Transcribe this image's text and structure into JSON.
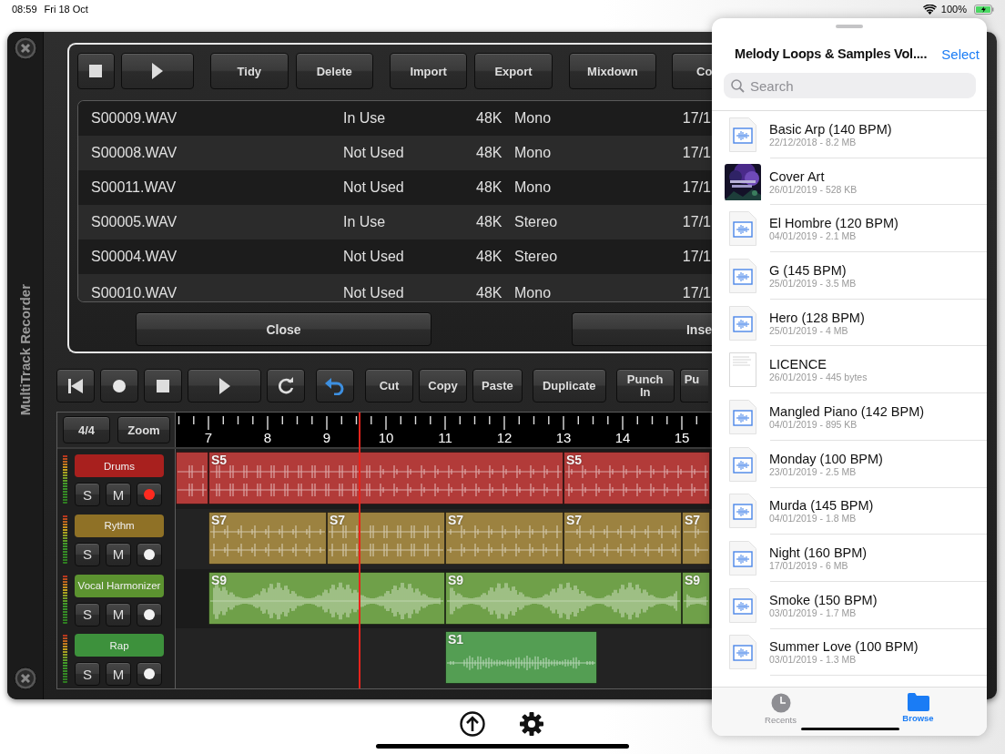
{
  "status_bar": {
    "time": "08:59",
    "date": "Fri 18 Oct",
    "battery": "100%"
  },
  "app": {
    "title": "MultiTrack Recorder",
    "dialog": {
      "toolbar": [
        {
          "kind": "stop"
        },
        {
          "kind": "play"
        },
        {
          "kind": "text",
          "label": "Tidy"
        },
        {
          "kind": "text",
          "label": "Delete"
        },
        {
          "kind": "text",
          "label": "Import"
        },
        {
          "kind": "text",
          "label": "Export"
        },
        {
          "kind": "text",
          "label": "Mixdown"
        },
        {
          "kind": "text",
          "label": "Co"
        }
      ],
      "files": [
        {
          "name": "S00009.WAV",
          "status": "In Use",
          "rate": "48K",
          "channels": "Mono",
          "date": "17/1"
        },
        {
          "name": "S00008.WAV",
          "status": "Not Used",
          "rate": "48K",
          "channels": "Mono",
          "date": "17/1"
        },
        {
          "name": "S00011.WAV",
          "status": "Not Used",
          "rate": "48K",
          "channels": "Mono",
          "date": "17/1"
        },
        {
          "name": "S00005.WAV",
          "status": "In Use",
          "rate": "48K",
          "channels": "Stereo",
          "date": "17/1"
        },
        {
          "name": "S00004.WAV",
          "status": "Not Used",
          "rate": "48K",
          "channels": "Stereo",
          "date": "17/1"
        },
        {
          "name": "S00010.WAV",
          "status": "Not Used",
          "rate": "48K",
          "channels": "Mono",
          "date": "17/1"
        }
      ],
      "buttons": [
        "Close",
        "Inse"
      ]
    },
    "transport": [
      {
        "kind": "rewind"
      },
      {
        "kind": "record"
      },
      {
        "kind": "stop"
      },
      {
        "kind": "play"
      },
      {
        "kind": "loop"
      },
      {
        "kind": "undo"
      },
      {
        "kind": "text",
        "label": "Cut"
      },
      {
        "kind": "text",
        "label": "Copy"
      },
      {
        "kind": "text",
        "label": "Paste"
      },
      {
        "kind": "text",
        "label": "Duplicate"
      },
      {
        "kind": "text",
        "label": "Punch In"
      },
      {
        "kind": "text",
        "label": "Pu"
      }
    ],
    "timeline": {
      "meter": "4/4",
      "zoom": "Zoom",
      "bars": [
        "7",
        "8",
        "9",
        "10",
        "11",
        "12",
        "13",
        "14",
        "15"
      ],
      "tracks": [
        {
          "name": "Drums",
          "color": "#a8201e",
          "solo": "S",
          "mute": "M",
          "armed": true,
          "clips": [
            {
              "label": "S5"
            },
            {
              "label": "S5"
            }
          ]
        },
        {
          "name": "Rythm",
          "color": "#8f7126",
          "solo": "S",
          "mute": "M",
          "armed": false,
          "clips": [
            {
              "label": "S7"
            },
            {
              "label": "S7"
            },
            {
              "label": "S7"
            },
            {
              "label": "S7"
            },
            {
              "label": "S7"
            }
          ]
        },
        {
          "name": "Vocal Harmonizer",
          "color": "#5c9330",
          "solo": "S",
          "mute": "M",
          "armed": false,
          "clips": [
            {
              "label": "S9"
            },
            {
              "label": "S9"
            },
            {
              "label": "S9"
            }
          ]
        },
        {
          "name": "Rap",
          "color": "#3d913c",
          "solo": "S",
          "mute": "M",
          "armed": false,
          "clips": [
            {
              "label": "S1"
            }
          ]
        }
      ]
    }
  },
  "browser": {
    "title": "Melody Loops & Samples Vol....",
    "select": "Select",
    "search": {
      "placeholder": "Search"
    },
    "items": [
      {
        "kind": "audio",
        "name": "Basic Arp (140 BPM)",
        "meta": "22/12/2018 - 8.2 MB"
      },
      {
        "kind": "picture",
        "name": "Cover Art",
        "meta": "26/01/2019 - 528 KB"
      },
      {
        "kind": "audio",
        "name": "El Hombre (120 BPM)",
        "meta": "04/01/2019 - 2.1 MB"
      },
      {
        "kind": "audio",
        "name": "G (145 BPM)",
        "meta": "25/01/2019 - 3.5 MB"
      },
      {
        "kind": "audio",
        "name": "Hero (128 BPM)",
        "meta": "25/01/2019 - 4 MB"
      },
      {
        "kind": "document",
        "name": "LICENCE",
        "meta": "26/01/2019 - 445 bytes"
      },
      {
        "kind": "audio",
        "name": "Mangled Piano (142 BPM)",
        "meta": "04/01/2019 - 895 KB"
      },
      {
        "kind": "audio",
        "name": "Monday (100 BPM)",
        "meta": "23/01/2019 - 2.5 MB"
      },
      {
        "kind": "audio",
        "name": "Murda (145 BPM)",
        "meta": "04/01/2019 - 1.8 MB"
      },
      {
        "kind": "audio",
        "name": "Night (160 BPM)",
        "meta": "17/01/2019 - 6 MB"
      },
      {
        "kind": "audio",
        "name": "Smoke (150 BPM)",
        "meta": "03/01/2019 - 1.7 MB"
      },
      {
        "kind": "audio",
        "name": "Summer Love (100 BPM)",
        "meta": "03/01/2019 - 1.3 MB"
      }
    ],
    "tabs": [
      {
        "kind": "recents",
        "label": "Recents",
        "selected": false
      },
      {
        "kind": "browse",
        "label": "Browse",
        "selected": true
      }
    ]
  }
}
